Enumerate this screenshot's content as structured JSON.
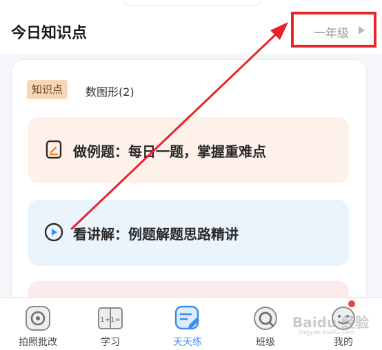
{
  "header": {
    "title": "今日知识点",
    "grade_selector": "一年级"
  },
  "knowledge": {
    "tag": "知识点",
    "topic_count": "数图形(2)"
  },
  "items": [
    {
      "icon": "edit-note-icon",
      "label": "做例题：每日一题，掌握重难点"
    },
    {
      "icon": "play-circle-icon",
      "label": "看讲解：例题解题思路精讲"
    }
  ],
  "nav": {
    "items": [
      {
        "icon": "camera-icon",
        "label": "拍照批改"
      },
      {
        "icon": "book-icon",
        "label": "学习"
      },
      {
        "icon": "practice-icon",
        "label": "天天练",
        "active": true
      },
      {
        "icon": "class-icon",
        "label": "班级"
      },
      {
        "icon": "profile-icon",
        "label": "我的"
      }
    ]
  },
  "watermark": {
    "brand": "Baidu 经验",
    "url": "jingyan.baidu.com"
  },
  "colors": {
    "accent": "#3a8ef0",
    "annotation_red": "#e8232a",
    "tag_bg": "#f8d7b8",
    "practice_bg": "#fdf1ea",
    "lecture_bg": "#e9f4fd"
  }
}
